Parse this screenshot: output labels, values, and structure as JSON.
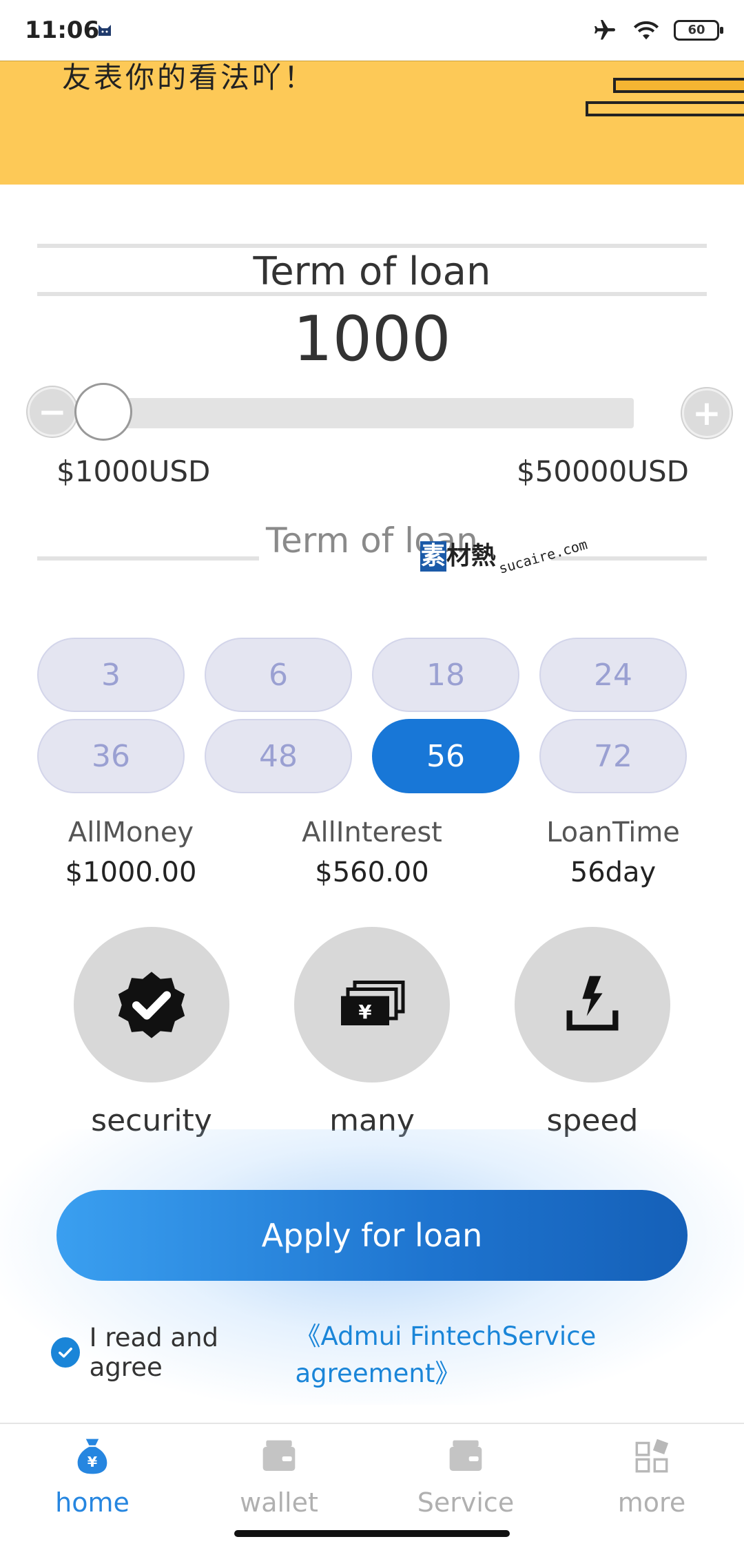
{
  "status_bar": {
    "time": "11:06",
    "battery": "60"
  },
  "banner": {
    "text": "友表你的看法吖！"
  },
  "loan": {
    "term_title": "Term of loan",
    "amount": "1000",
    "min_label": "$1000USD",
    "max_label": "$50000USD",
    "minus_symbol": "−",
    "plus_symbol": "+",
    "slider_fraction": 0
  },
  "term_section": {
    "title": "Term of loan"
  },
  "watermark": {
    "brand": "材熱",
    "brand_mark": "素",
    "url": "sucaire.com"
  },
  "terms": [
    {
      "label": "3",
      "active": false
    },
    {
      "label": "6",
      "active": false
    },
    {
      "label": "18",
      "active": false
    },
    {
      "label": "24",
      "active": false
    },
    {
      "label": "36",
      "active": false
    },
    {
      "label": "48",
      "active": false
    },
    {
      "label": "56",
      "active": true
    },
    {
      "label": "72",
      "active": false
    }
  ],
  "stats": [
    {
      "label": "AllMoney",
      "value": "$1000.00"
    },
    {
      "label": "AllInterest",
      "value": "$560.00"
    },
    {
      "label": "LoanTime",
      "value": "56day"
    }
  ],
  "features": [
    {
      "label": "security",
      "icon": "verified-badge-icon"
    },
    {
      "label": "many",
      "icon": "money-stack-icon"
    },
    {
      "label": "speed",
      "icon": "lightning-icon"
    }
  ],
  "apply_button": "Apply for loan",
  "agreement": {
    "prefix": "I read and agree",
    "link": "《Admui FintechService agreement》",
    "checked": true
  },
  "tabbar": [
    {
      "label": "home",
      "icon": "money-bag-icon",
      "active": true
    },
    {
      "label": "wallet",
      "icon": "wallet-icon",
      "active": false
    },
    {
      "label": "Service",
      "icon": "service-icon",
      "active": false
    },
    {
      "label": "more",
      "icon": "grid-icon",
      "active": false
    }
  ],
  "colors": {
    "accent": "#1877d7",
    "banner": "#fdc957",
    "tab_active": "#2686e0"
  }
}
